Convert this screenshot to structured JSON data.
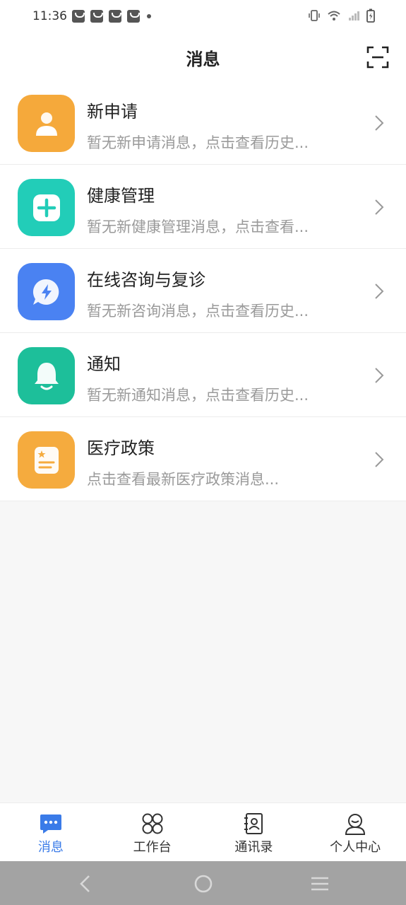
{
  "status_bar": {
    "time": "11:36"
  },
  "header": {
    "title": "消息"
  },
  "messages": [
    {
      "title": "新申请",
      "subtitle": "暂无新申请消息，点击查看历史...",
      "icon": "person-icon",
      "color": "#f5a93b"
    },
    {
      "title": "健康管理",
      "subtitle": "暂无新健康管理消息，点击查看...",
      "icon": "plus-icon",
      "color": "#22cdb8"
    },
    {
      "title": "在线咨询与复诊",
      "subtitle": "暂无新咨询消息，点击查看历史...",
      "icon": "chat-lightning-icon",
      "color": "#4a82f2"
    },
    {
      "title": "通知",
      "subtitle": "暂无新通知消息，点击查看历史...",
      "icon": "bell-icon",
      "color": "#1dbf9a"
    },
    {
      "title": "医疗政策",
      "subtitle": "点击查看最新医疗政策消息...",
      "icon": "policy-doc-icon",
      "color": "#f5ab3e"
    }
  ],
  "tabs": [
    {
      "label": "消息",
      "icon": "chat-bubble-icon",
      "active": true
    },
    {
      "label": "工作台",
      "icon": "workbench-grid-icon",
      "active": false
    },
    {
      "label": "通讯录",
      "icon": "contacts-book-icon",
      "active": false
    },
    {
      "label": "个人中心",
      "icon": "user-profile-icon",
      "active": false
    }
  ],
  "colors": {
    "accent": "#3a7be8",
    "background": "#f7f7f7"
  }
}
